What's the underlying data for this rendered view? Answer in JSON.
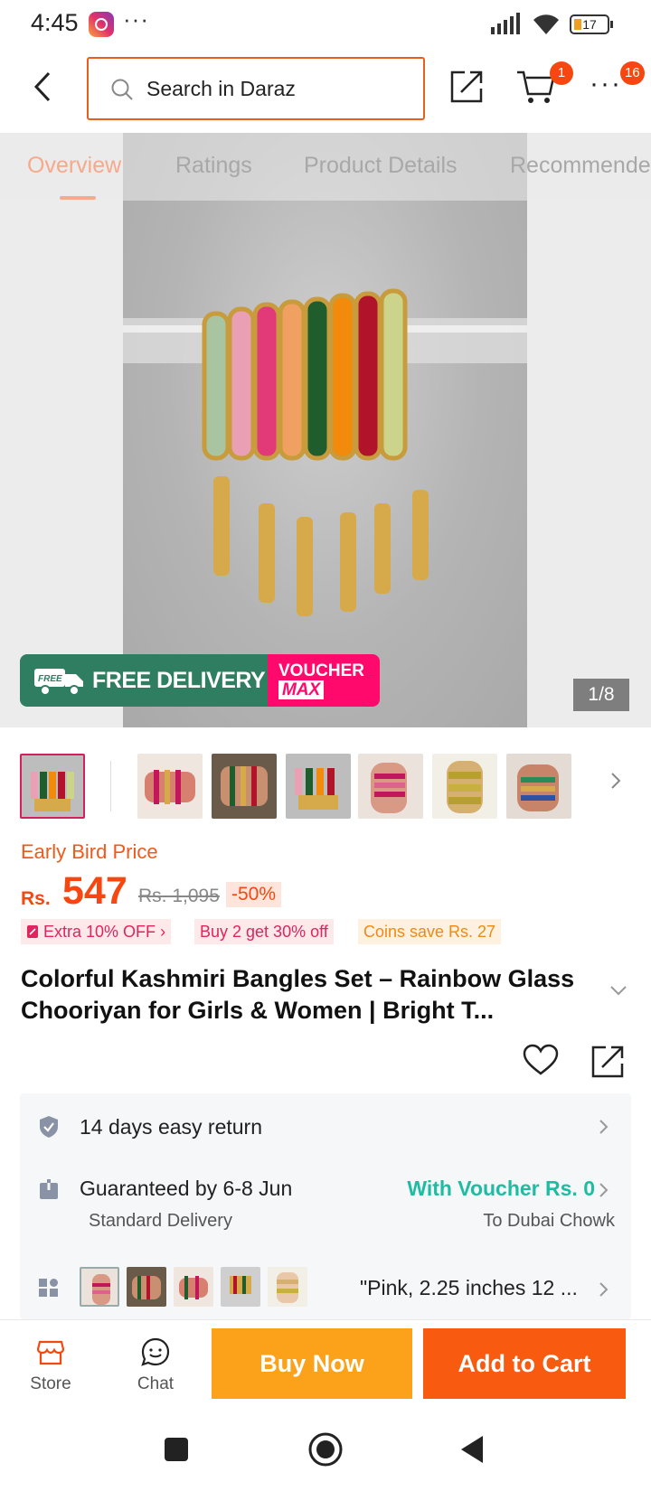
{
  "status": {
    "time": "4:45",
    "battery": "17"
  },
  "header": {
    "search_placeholder": "Search in Daraz",
    "cart_count": "1",
    "more_count": "16"
  },
  "tabs": [
    {
      "label": "Overview"
    },
    {
      "label": "Ratings"
    },
    {
      "label": "Product Details"
    },
    {
      "label": "Recommended"
    }
  ],
  "gallery": {
    "counter": "1/8",
    "free_delivery": "FREE DELIVERY",
    "free_tag": "FREE",
    "voucher_line1": "VOUCHER",
    "voucher_line2": "MAX"
  },
  "price": {
    "early_bird": "Early Bird Price",
    "currency": "Rs.",
    "amount": "547",
    "original": "Rs. 1,095",
    "discount": "-50%"
  },
  "promos": {
    "extra": "Extra 10% OFF",
    "bundle": "Buy 2 get 30% off",
    "coins": "Coins save Rs. 27"
  },
  "product": {
    "title": "Colorful Kashmiri Bangles Set – Rainbow Glass Chooriyan for Girls & Women | Bright T..."
  },
  "service": {
    "return_text": "14 days easy return",
    "delivery_text": "Guaranteed by 6-8 Jun",
    "delivery_sub": "Standard Delivery",
    "voucher_text": "With Voucher Rs. 0",
    "location": "To Dubai Chowk",
    "variant_text": "\"Pink, 2.25 inches 12 ..."
  },
  "bottom_bar": {
    "store": "Store",
    "chat": "Chat",
    "buy_now": "Buy Now",
    "add_to_cart": "Add to Cart"
  },
  "colors": {
    "accent": "#f5470f",
    "buy": "#fca11a",
    "add": "#f85b10",
    "voucher": "#1ebca0"
  }
}
